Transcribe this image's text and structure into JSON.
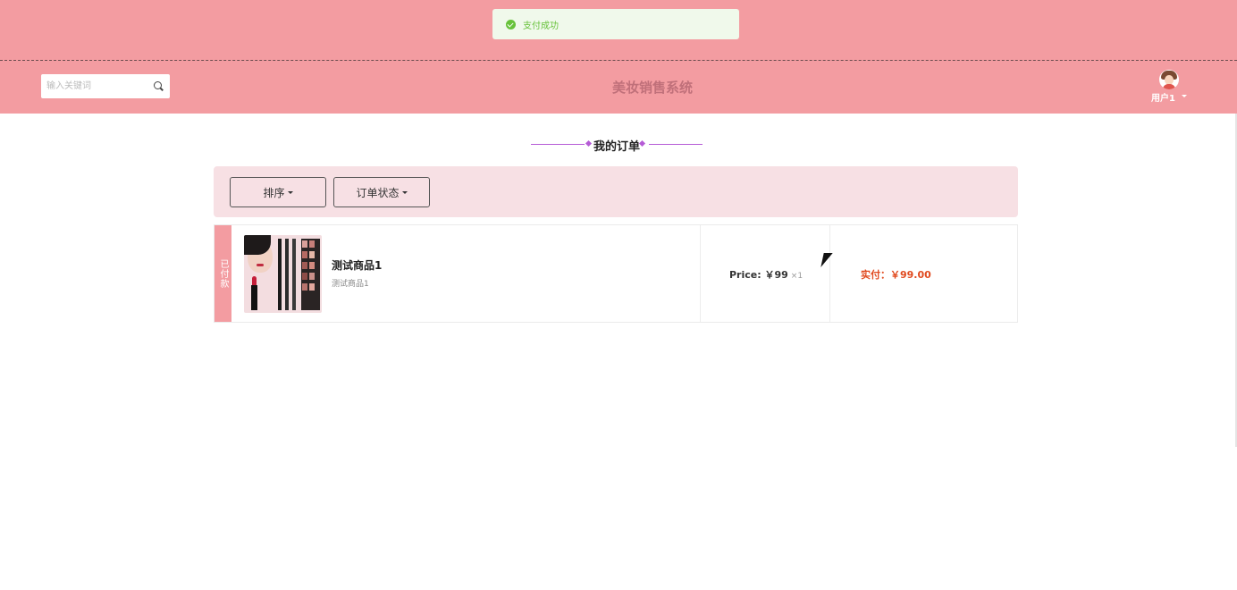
{
  "toast": {
    "message": "支付成功"
  },
  "header": {
    "search_placeholder": "输入关键词",
    "site_title": "美妆销售系统",
    "user_name": "用户1"
  },
  "page": {
    "heading": "我的订单",
    "filters": {
      "sort_label": "排序",
      "status_label": "订单状态"
    }
  },
  "orders": [
    {
      "status": "已付款",
      "product_name": "测试商品1",
      "product_desc": "测试商品1",
      "price_label": "Price:",
      "price": "￥99",
      "qty": "×1",
      "paid_label": "实付：",
      "paid_amount": "￥99.00"
    }
  ],
  "colors": {
    "brand_pink": "#f39ca1",
    "filter_bg": "#f7e0e4",
    "success": "#67c23a",
    "paid_red": "#e04a1f"
  }
}
